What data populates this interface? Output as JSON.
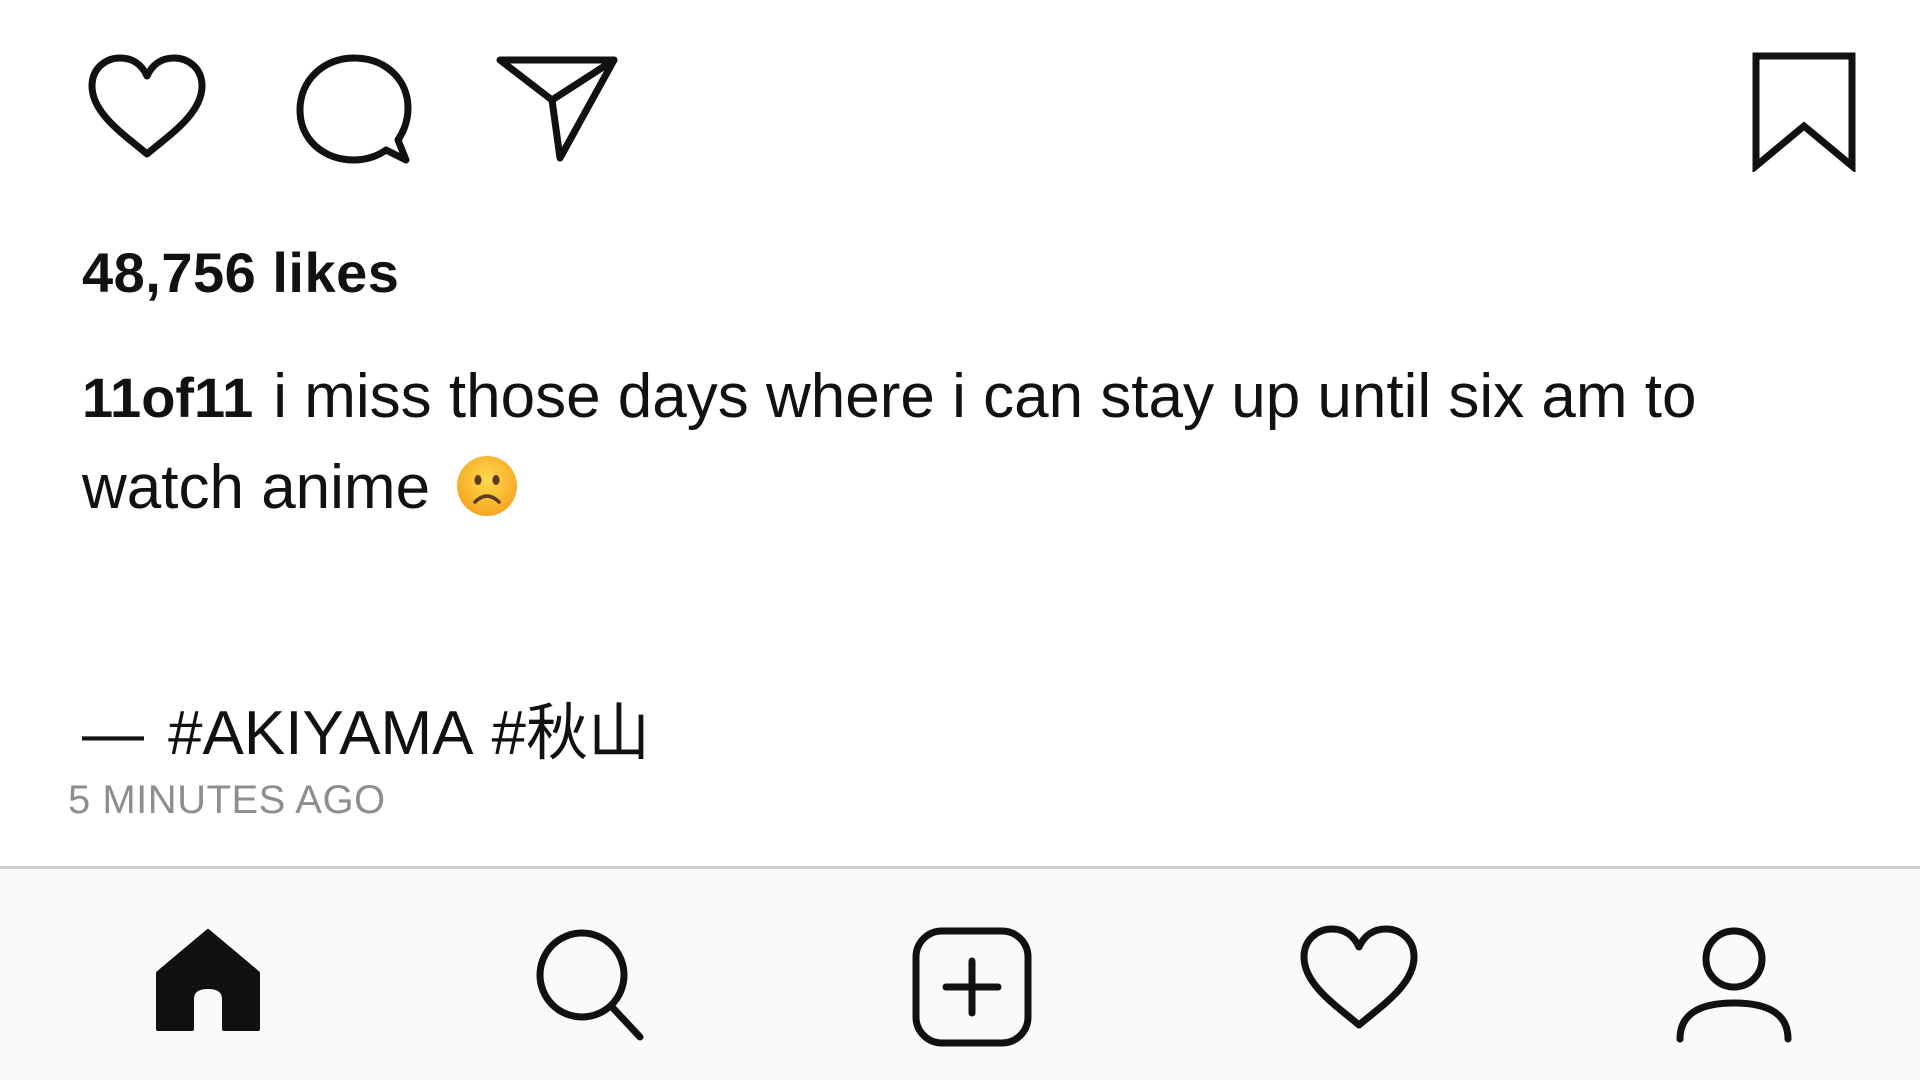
{
  "post": {
    "actions": {
      "like_icon": "heart-outline-icon",
      "comment_icon": "comment-bubble-icon",
      "share_icon": "paper-plane-icon",
      "save_icon": "bookmark-icon"
    },
    "likes_text": "48,756 likes",
    "caption": {
      "username": "11of11",
      "text": "i miss those days where i can stay up until six am to watch anime",
      "emoji": "frowning-face-emoji"
    },
    "hashtags": {
      "dash": "—",
      "tags": [
        "#AKIYAMA",
        "#秋山"
      ]
    },
    "timestamp": "5 MINUTES AGO"
  },
  "tabbar": {
    "tabs": [
      {
        "icon": "home-icon",
        "active": true
      },
      {
        "icon": "search-icon",
        "active": false
      },
      {
        "icon": "new-post-icon",
        "active": false
      },
      {
        "icon": "activity-heart-icon",
        "active": false
      },
      {
        "icon": "profile-icon",
        "active": false
      }
    ]
  },
  "colors": {
    "text": "#111111",
    "muted": "#8e8e8e",
    "tabbar_bg": "#fafafa",
    "divider": "#d0d0d0",
    "emoji_yellow": "#f7b630"
  }
}
